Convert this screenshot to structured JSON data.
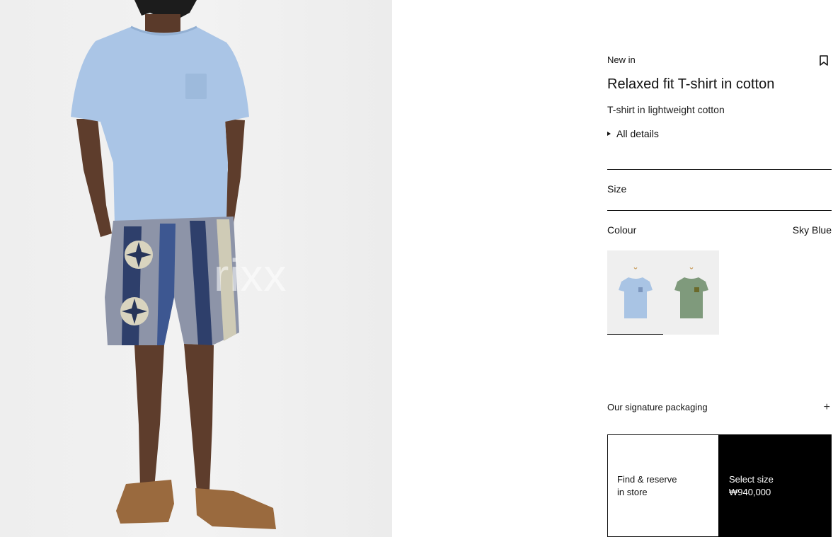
{
  "photo": {
    "alt": "Model wearing the sky blue relaxed fit T-shirt",
    "watermark": "rixx"
  },
  "product": {
    "badge": "New in",
    "title": "Relaxed fit T-shirt in cotton",
    "subtitle": "T-shirt in lightweight cotton",
    "details_label": "All details"
  },
  "size": {
    "label": "Size"
  },
  "colour": {
    "label": "Colour",
    "selected": "Sky Blue",
    "swatches": [
      {
        "name": "Sky Blue",
        "hex": "#a9c4e4",
        "selected": true
      },
      {
        "name": "Green",
        "hex": "#7f9a7c",
        "selected": false
      }
    ]
  },
  "packaging": {
    "label": "Our signature packaging"
  },
  "actions": {
    "store_line1": "Find & reserve",
    "store_line2": "in store",
    "buy_line1": "Select size",
    "buy_price": "₩940,000"
  },
  "colors": {
    "accent": "#000000",
    "background": "#ffffff"
  }
}
